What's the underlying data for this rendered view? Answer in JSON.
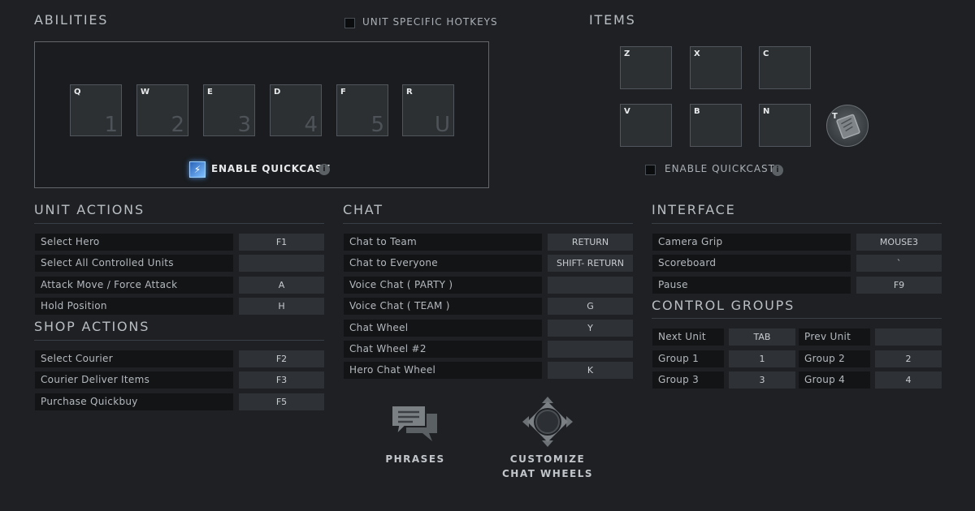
{
  "abilities": {
    "title": "ABILITIES",
    "unit_specific_hotkeys": "UNIT SPECIFIC HOTKEYS",
    "slots": [
      {
        "key": "Q",
        "num": "1"
      },
      {
        "key": "W",
        "num": "2"
      },
      {
        "key": "E",
        "num": "3"
      },
      {
        "key": "D",
        "num": "4"
      },
      {
        "key": "F",
        "num": "5"
      },
      {
        "key": "R",
        "num": "U"
      }
    ],
    "quickcast_label": "ENABLE QUICKCAST",
    "quickcast_enabled": true
  },
  "items": {
    "title": "ITEMS",
    "slots": [
      "Z",
      "X",
      "C",
      "V",
      "B",
      "N"
    ],
    "tp_key": "T",
    "quickcast_label": "ENABLE QUICKCAST",
    "quickcast_enabled": false
  },
  "unit_actions": {
    "title": "UNIT ACTIONS",
    "rows": [
      {
        "name": "Select Hero",
        "key": "F1"
      },
      {
        "name": "Select All Controlled Units",
        "key": ""
      },
      {
        "name": "Attack Move / Force Attack",
        "key": "A"
      },
      {
        "name": "Hold Position",
        "key": "H"
      }
    ]
  },
  "shop_actions": {
    "title": "SHOP ACTIONS",
    "rows": [
      {
        "name": "Select Courier",
        "key": "F2"
      },
      {
        "name": "Courier Deliver Items",
        "key": "F3"
      },
      {
        "name": "Purchase Quickbuy",
        "key": "F5"
      }
    ]
  },
  "chat": {
    "title": "CHAT",
    "rows": [
      {
        "name": "Chat to Team",
        "key": "RETURN"
      },
      {
        "name": "Chat to Everyone",
        "key": "SHIFT- RETURN"
      },
      {
        "name": "Voice Chat ( PARTY )",
        "key": ""
      },
      {
        "name": "Voice Chat ( TEAM )",
        "key": "G"
      },
      {
        "name": "Chat Wheel",
        "key": "Y"
      },
      {
        "name": "Chat Wheel #2",
        "key": ""
      },
      {
        "name": "Hero Chat Wheel",
        "key": "K"
      }
    ],
    "phrases_label": "PHRASES",
    "customize_label_1": "CUSTOMIZE",
    "customize_label_2": "CHAT WHEELS"
  },
  "interface": {
    "title": "INTERFACE",
    "rows": [
      {
        "name": "Camera Grip",
        "key": "MOUSE3"
      },
      {
        "name": "Scoreboard",
        "key": "`"
      },
      {
        "name": "Pause",
        "key": "F9"
      }
    ]
  },
  "control_groups": {
    "title": "CONTROL GROUPS",
    "rows": [
      {
        "left_name": "Next Unit",
        "left_key": "TAB",
        "right_name": "Prev Unit",
        "right_key": ""
      },
      {
        "left_name": "Group 1",
        "left_key": "1",
        "right_name": "Group 2",
        "right_key": "2"
      },
      {
        "left_name": "Group 3",
        "left_key": "3",
        "right_name": "Group 4",
        "right_key": "4"
      }
    ]
  },
  "colors": {
    "background": "#1e2024",
    "slot": "#2c3033",
    "binding_name_bg": "#131416",
    "binding_key_bg": "#2e3236",
    "quickcast_accent": "#4a90e2"
  }
}
